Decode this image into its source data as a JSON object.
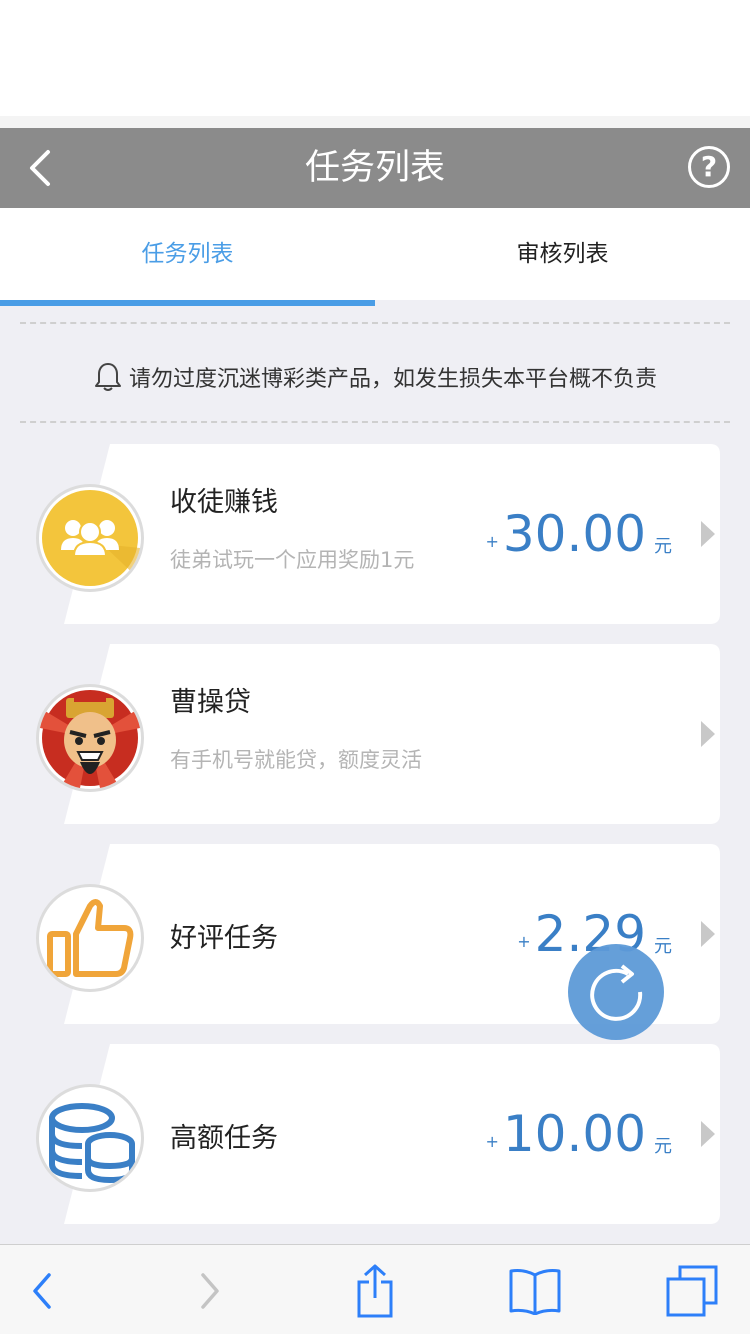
{
  "nav": {
    "title": "任务列表",
    "back_icon": "chevron-left-icon",
    "help_label": "?"
  },
  "tabs": [
    {
      "label": "任务列表",
      "active": true
    },
    {
      "label": "审核列表",
      "active": false
    }
  ],
  "notice": {
    "text": "请勿过度沉迷博彩类产品，如发生损失本平台概不负责",
    "icon": "bell-icon"
  },
  "tasks": [
    {
      "title": "收徒赚钱",
      "subtitle": "徒弟试玩一个应用奖励1元",
      "plus": "+",
      "amount": "30.00",
      "unit": "元",
      "icon": "users-icon"
    },
    {
      "title": "曹操贷",
      "subtitle": "有手机号就能贷，额度灵活",
      "plus": "",
      "amount": "",
      "unit": "",
      "icon": "character-avatar-icon"
    },
    {
      "title": "好评任务",
      "subtitle": "",
      "plus": "+",
      "amount": "2.29",
      "unit": "元",
      "icon": "thumbs-up-icon"
    },
    {
      "title": "高额任务",
      "subtitle": "",
      "plus": "+",
      "amount": "10.00",
      "unit": "元",
      "icon": "database-icon"
    }
  ],
  "colors": {
    "accent": "#4a9de6",
    "amount": "#3a7fc6",
    "navbar": "#8b8b8b"
  },
  "toolbar": [
    "back-icon",
    "forward-icon",
    "share-icon",
    "bookmarks-icon",
    "tabs-icon"
  ]
}
